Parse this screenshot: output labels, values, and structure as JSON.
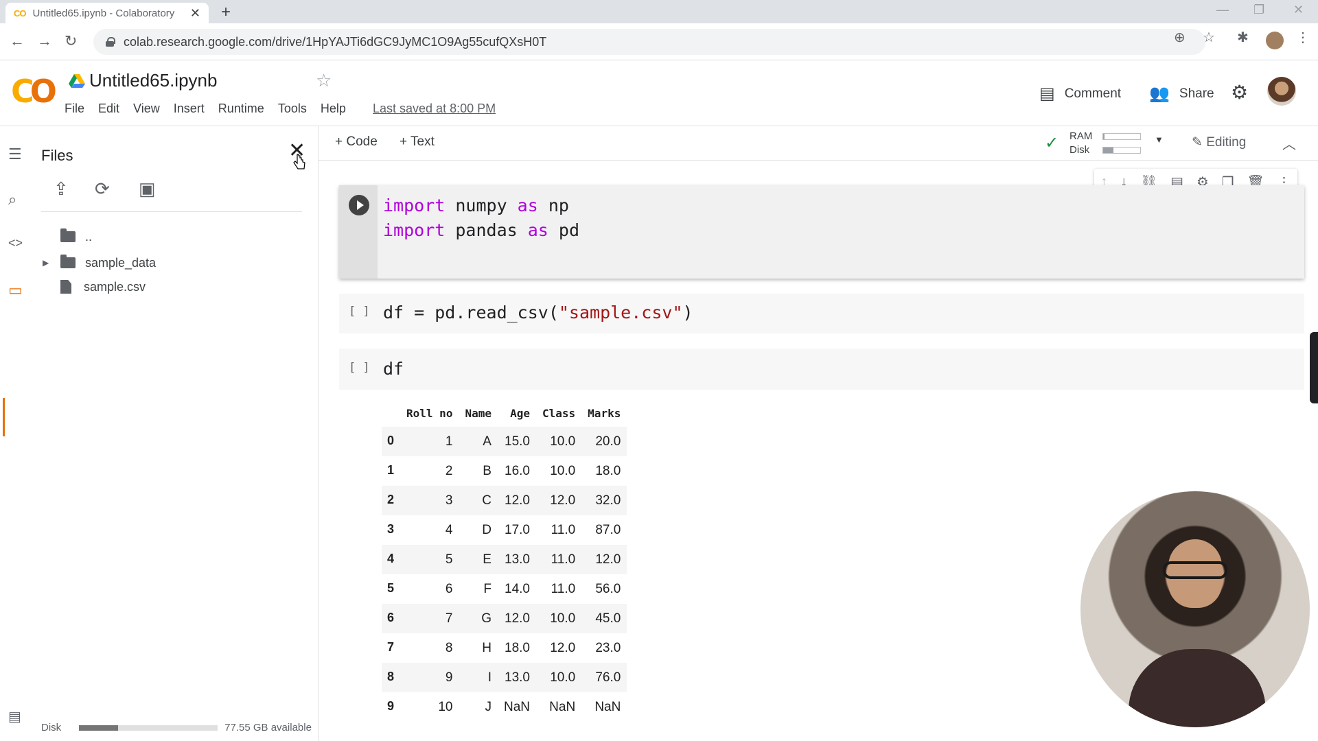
{
  "browser": {
    "tab_title": "Untitled65.ipynb - Colaboratory",
    "tab_favicon": "CO",
    "url": "colab.research.google.com/drive/1HpYAJTi6dGC9JyMC1O9Ag55cufQXsH0T"
  },
  "header": {
    "notebook_title": "Untitled65.ipynb",
    "menu": [
      "File",
      "Edit",
      "View",
      "Insert",
      "Runtime",
      "Tools",
      "Help"
    ],
    "last_saved": "Last saved at 8:00 PM",
    "comment_label": "Comment",
    "share_label": "Share"
  },
  "files_panel": {
    "title": "Files",
    "tree": [
      {
        "label": "..",
        "type": "parent-folder"
      },
      {
        "label": "sample_data",
        "type": "folder"
      },
      {
        "label": "sample.csv",
        "type": "file"
      }
    ],
    "disk_label": "Disk",
    "disk_available": "77.55 GB available",
    "disk_used_fraction": 0.28
  },
  "notebook": {
    "add_code_label": "+ Code",
    "add_text_label": "+ Text",
    "ram_label": "RAM",
    "disk_label": "Disk",
    "ram_fraction": 0.04,
    "disk_fraction": 0.27,
    "editing_label": "Editing",
    "cells": [
      {
        "lines": [
          "import numpy as np",
          "import pandas as pd"
        ]
      },
      {
        "bracket": "[ ]",
        "code": "df = pd.read_csv(\"sample.csv\")"
      },
      {
        "bracket": "[ ]",
        "code": "df"
      }
    ]
  },
  "dataframe": {
    "columns": [
      "Roll no",
      "Name",
      "Age",
      "Class",
      "Marks"
    ],
    "rows": [
      {
        "index": "0",
        "values": [
          "1",
          "A",
          "15.0",
          "10.0",
          "20.0"
        ]
      },
      {
        "index": "1",
        "values": [
          "2",
          "B",
          "16.0",
          "10.0",
          "18.0"
        ]
      },
      {
        "index": "2",
        "values": [
          "3",
          "C",
          "12.0",
          "12.0",
          "32.0"
        ]
      },
      {
        "index": "3",
        "values": [
          "4",
          "D",
          "17.0",
          "11.0",
          "87.0"
        ]
      },
      {
        "index": "4",
        "values": [
          "5",
          "E",
          "13.0",
          "11.0",
          "12.0"
        ]
      },
      {
        "index": "5",
        "values": [
          "6",
          "F",
          "14.0",
          "11.0",
          "56.0"
        ]
      },
      {
        "index": "6",
        "values": [
          "7",
          "G",
          "12.0",
          "10.0",
          "45.0"
        ]
      },
      {
        "index": "7",
        "values": [
          "8",
          "H",
          "18.0",
          "12.0",
          "23.0"
        ]
      },
      {
        "index": "8",
        "values": [
          "9",
          "I",
          "13.0",
          "10.0",
          "76.0"
        ]
      },
      {
        "index": "9",
        "values": [
          "10",
          "J",
          "NaN",
          "NaN",
          "NaN"
        ]
      }
    ]
  },
  "colors": {
    "accent_orange": "#e8710a",
    "logo_yellow": "#f9ab00",
    "keyword": "#af00db",
    "string": "#a31515"
  }
}
